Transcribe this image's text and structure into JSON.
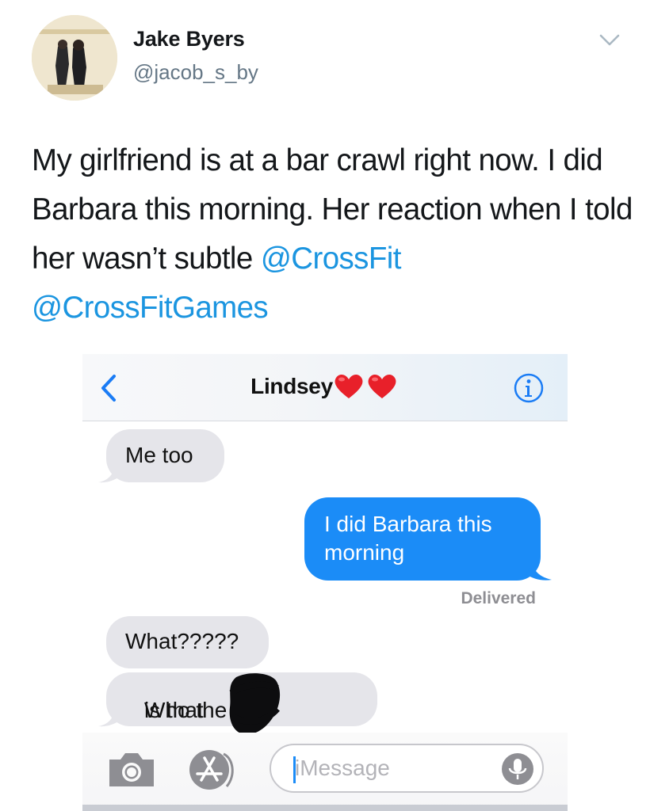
{
  "tweet": {
    "author_name": "Jake Byers",
    "author_handle": "@jacob_s_by",
    "text_plain": "My girlfriend is at a bar crawl right now. I did Barbara this morning. Her reaction when I told her wasn’t subtle ",
    "mention_1": "@CrossFit",
    "mention_2": "@CrossFitGames",
    "menu_icon": "chevron-down-icon"
  },
  "imessage": {
    "contact_name": "Lindsey",
    "contact_emoji": "❤️❤️",
    "back_icon": "chevron-left-icon",
    "info_icon": "info-icon",
    "messages": [
      {
        "direction": "received",
        "text": "Me too"
      },
      {
        "direction": "sent",
        "text": "I did Barbara this morning"
      },
      {
        "direction": "received",
        "text": "What?????"
      },
      {
        "direction": "received",
        "text": "Who the f**k is that",
        "text_visible_left": "Who the",
        "text_visible_right": "is that"
      }
    ],
    "status": "Delivered",
    "input_placeholder": "iMessage",
    "toolbar_icons": [
      "camera-icon",
      "app-store-icon",
      "microphone-icon"
    ]
  },
  "colors": {
    "mention": "#1b95e0",
    "sent_bubble": "#1b8cf7",
    "received_bubble": "#e5e5ea",
    "handle": "#657786",
    "ios_blue": "#1a7cf5"
  }
}
